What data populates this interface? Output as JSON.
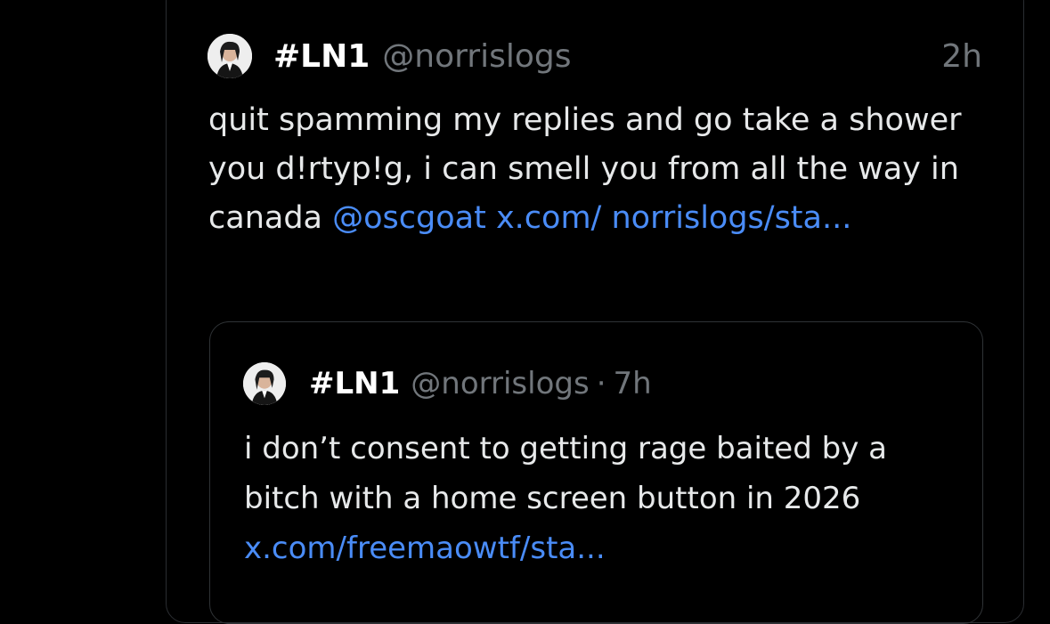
{
  "tweet": {
    "display_name": "#LN1",
    "handle": "@norrislogs",
    "time": "2h",
    "text_plain": "quit spamming my replies and go take a shower you d!rtyp!g, i can smell you from all the way in canada ",
    "mention": "@oscgoat",
    "link": "x.com/ norrislogs/sta..."
  },
  "quoted_tweet": {
    "display_name": "#LN1",
    "handle": "@norrislogs",
    "separator": "·",
    "time": "7h",
    "text_plain": "i don’t consent to getting rage baited by a bitch with a home screen button in 2026 ",
    "link": "x.com/freemaowtf/sta..."
  },
  "colors": {
    "background": "#000000",
    "primary_text": "#e7e9ea",
    "secondary_text": "#71767b",
    "link": "#4a8cf7",
    "border": "#2f3336"
  },
  "icons": {
    "avatar": "profile-avatar",
    "quoted_avatar": "profile-avatar"
  }
}
